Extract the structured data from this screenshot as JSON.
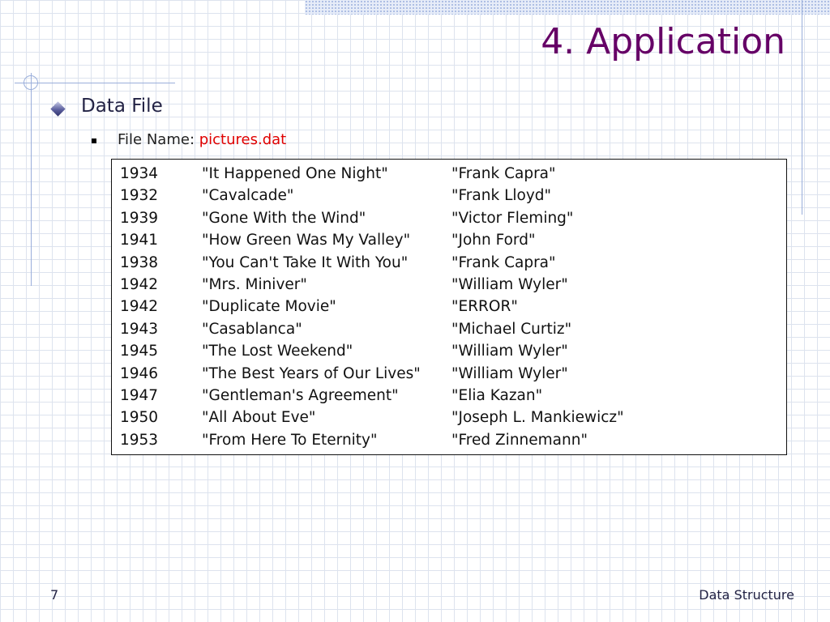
{
  "slide": {
    "title": "4. Application",
    "bullet_level1": "Data File",
    "bullet_level2_label": "File Name: ",
    "bullet_level2_value": "pictures.dat",
    "records": [
      {
        "year": "1934",
        "title": "\"It Happened One Night\"",
        "director": "\"Frank Capra\""
      },
      {
        "year": "1932",
        "title": "\"Cavalcade\"",
        "director": "\"Frank Lloyd\""
      },
      {
        "year": "1939",
        "title": "\"Gone With the Wind\"",
        "director": "\"Victor Fleming\""
      },
      {
        "year": "1941",
        "title": "\"How Green Was My Valley\"",
        "director": "\"John Ford\""
      },
      {
        "year": "1938",
        "title": "\"You Can't Take It With You\"",
        "director": "\"Frank Capra\""
      },
      {
        "year": "1942",
        "title": "\"Mrs. Miniver\"",
        "director": "\"William Wyler\""
      },
      {
        "year": "1942",
        "title": "\"Duplicate Movie\"",
        "director": "\"ERROR\""
      },
      {
        "year": "1943",
        "title": "\"Casablanca\"",
        "director": "\"Michael Curtiz\""
      },
      {
        "year": "1945",
        "title": "\"The Lost Weekend\"",
        "director": "\"William Wyler\""
      },
      {
        "year": "1946",
        "title": "\"The Best Years of Our Lives\"",
        "director": "\"William Wyler\""
      },
      {
        "year": "1947",
        "title": "\"Gentleman's Agreement\"",
        "director": "\"Elia Kazan\""
      },
      {
        "year": "1950",
        "title": "\"All About Eve\"",
        "director": "\"Joseph L. Mankiewicz\""
      },
      {
        "year": "1953",
        "title": "\"From Here To Eternity\"",
        "director": "\"Fred Zinnemann\""
      }
    ]
  },
  "footer": {
    "page_number": "7",
    "text": "Data Structure"
  },
  "colors": {
    "title": "#660066",
    "filename": "#e00000",
    "grid": "#dde3ee",
    "accent_lines": "#9aaedb"
  },
  "icons": {
    "level1_bullet": "diamond-bullet-icon",
    "level2_bullet": "square-bullet-icon"
  }
}
